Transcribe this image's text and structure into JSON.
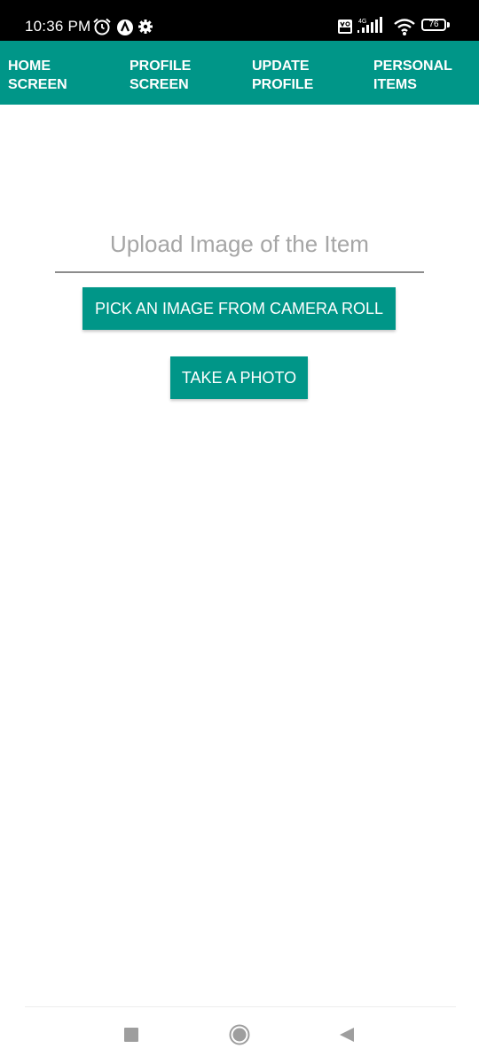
{
  "status_bar": {
    "time": "10:36 PM",
    "battery": "76"
  },
  "tabs": [
    {
      "label": "HOME\nSCREEN"
    },
    {
      "label": "PROFILE\nSCREEN"
    },
    {
      "label": "UPDATE\nPROFILE"
    },
    {
      "label": "PERSONAL\nITEMS"
    }
  ],
  "main": {
    "title": "Upload Image of the Item",
    "pick_button": "PICK AN IMAGE FROM CAMERA ROLL",
    "photo_button": "TAKE A PHOTO"
  },
  "colors": {
    "accent": "#009688",
    "status_bar": "#000000",
    "title_text": "#a6a6a6"
  },
  "icons": {
    "status": [
      "alarm-icon",
      "app-notification-icon",
      "settings-icon",
      "volte-icon",
      "4g-signal-icon",
      "wifi-icon",
      "battery-icon"
    ],
    "nav": [
      "recent-apps-icon",
      "home-icon",
      "back-icon"
    ]
  }
}
